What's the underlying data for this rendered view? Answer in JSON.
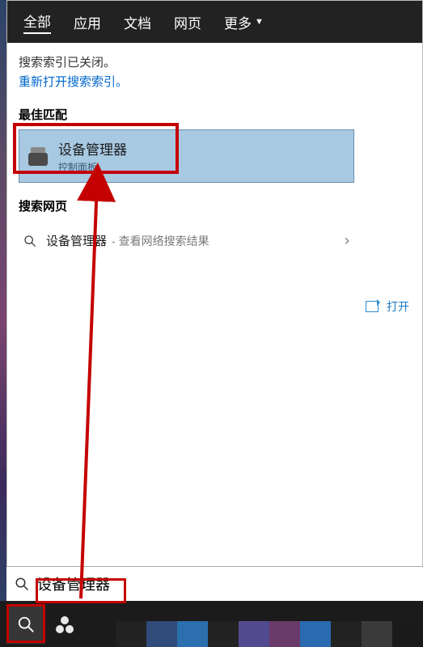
{
  "tabs": {
    "all": "全部",
    "apps": "应用",
    "docs": "文档",
    "web": "网页",
    "more": "更多"
  },
  "notice": {
    "line1": "搜索索引已关闭。",
    "link": "重新打开搜索索引。"
  },
  "sections": {
    "best_match": "最佳匹配",
    "search_web": "搜索网页"
  },
  "best_match": {
    "title": "设备管理器",
    "subtitle": "控制面板"
  },
  "web_result": {
    "term": "设备管理器",
    "hint": "- 查看网络搜索结果"
  },
  "actions": {
    "open": "打开"
  },
  "search": {
    "value": "设备管理器"
  }
}
